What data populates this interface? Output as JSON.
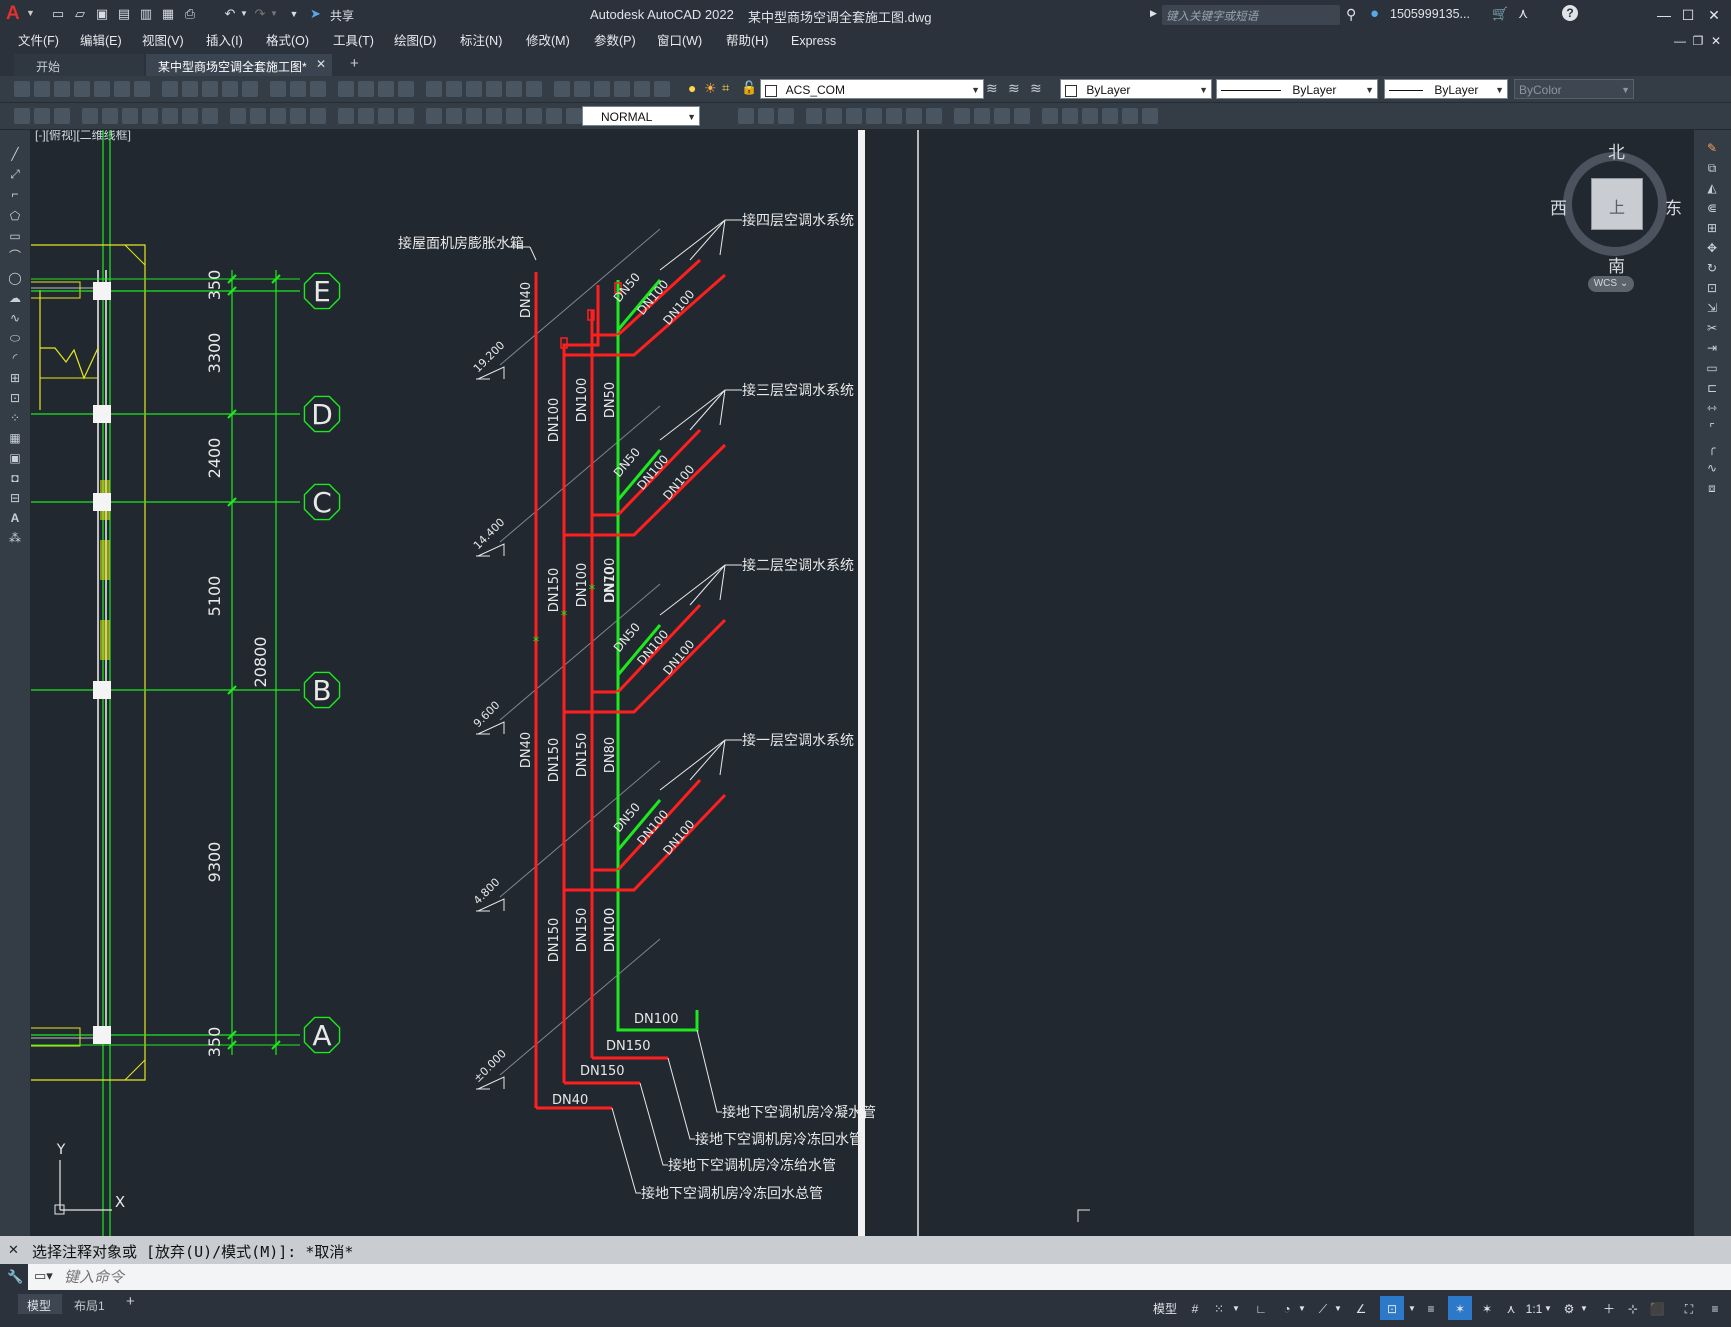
{
  "app": {
    "logo": "A",
    "title": "Autodesk AutoCAD 2022",
    "document_title": "某中型商场空调全套施工图.dwg",
    "share_label": "共享",
    "search_placeholder": "键入关键字或短语",
    "user": "1505999135...",
    "help_icon": "?"
  },
  "menu": [
    "文件(F)",
    "编辑(E)",
    "视图(V)",
    "插入(I)",
    "格式(O)",
    "工具(T)",
    "绘图(D)",
    "标注(N)",
    "修改(M)",
    "参数(P)",
    "窗口(W)",
    "帮助(H)",
    "Express"
  ],
  "tabs": {
    "start": "开始",
    "active": "某中型商场空调全套施工图*",
    "add": "+"
  },
  "toolbar": {
    "layer": "ACS_COM",
    "color": "ByLayer",
    "linetype": "ByLayer",
    "lineweight": "ByLayer",
    "plotstyle": "ByColor",
    "dimstyle": "NORMAL"
  },
  "viewport": {
    "label": "[-][俯视][二维线框]",
    "viewcube": {
      "north": "北",
      "south": "南",
      "east": "东",
      "west": "西",
      "top": "上",
      "wcs": "WCS"
    }
  },
  "drawing": {
    "grid_labels": [
      "E",
      "D",
      "C",
      "B",
      "A"
    ],
    "dims": [
      "350",
      "3300",
      "2400",
      "5100",
      "20800",
      "9300",
      "350"
    ],
    "elevations": [
      "19.200",
      "14.400",
      "9.600",
      "4.800",
      "±0.000"
    ],
    "top_label": "接屋面机房膨胀水箱",
    "floor_labels": [
      "接四层空调水系统",
      "接三层空调水系统",
      "接二层空调水系统",
      "接一层空调水系统"
    ],
    "bottom_labels": [
      "接地下空调机房冷凝水管",
      "接地下空调机房冷冻回水管",
      "接地下空调机房冷冻给水管",
      "接地下空调机房冷冻回水总管"
    ],
    "pipe_labels": {
      "main": [
        "DN40",
        "DN100",
        "DN40",
        "DN150",
        "DN150",
        "DN100",
        "DN150",
        "DN100"
      ],
      "floor4": [
        "DN50",
        "DN100",
        "DN100"
      ],
      "riser3": [
        "DN100",
        "DN50"
      ],
      "floor3": [
        "DN50",
        "DN100",
        "DN100"
      ],
      "riser2": [
        "DN100",
        "DN70"
      ],
      "floor2": [
        "DN50",
        "DN100",
        "DN100"
      ],
      "riser1": [
        "DN150",
        "DN80"
      ],
      "floor1": [
        "DN50",
        "DN100",
        "DN100"
      ],
      "riser0": [
        "DN150",
        "DN100"
      ],
      "bottom": [
        "DN100",
        "DN150",
        "DN150",
        "DN40"
      ]
    },
    "ucs": {
      "y": "Y",
      "x": "X"
    }
  },
  "command": {
    "history": "选择注释对象或 [放弃(U)/模式(M)]: *取消*",
    "placeholder": "键入命令"
  },
  "status": {
    "tabs": [
      "模型",
      "布局1"
    ],
    "add": "+",
    "model_label": "模型",
    "scale": "1:1"
  }
}
